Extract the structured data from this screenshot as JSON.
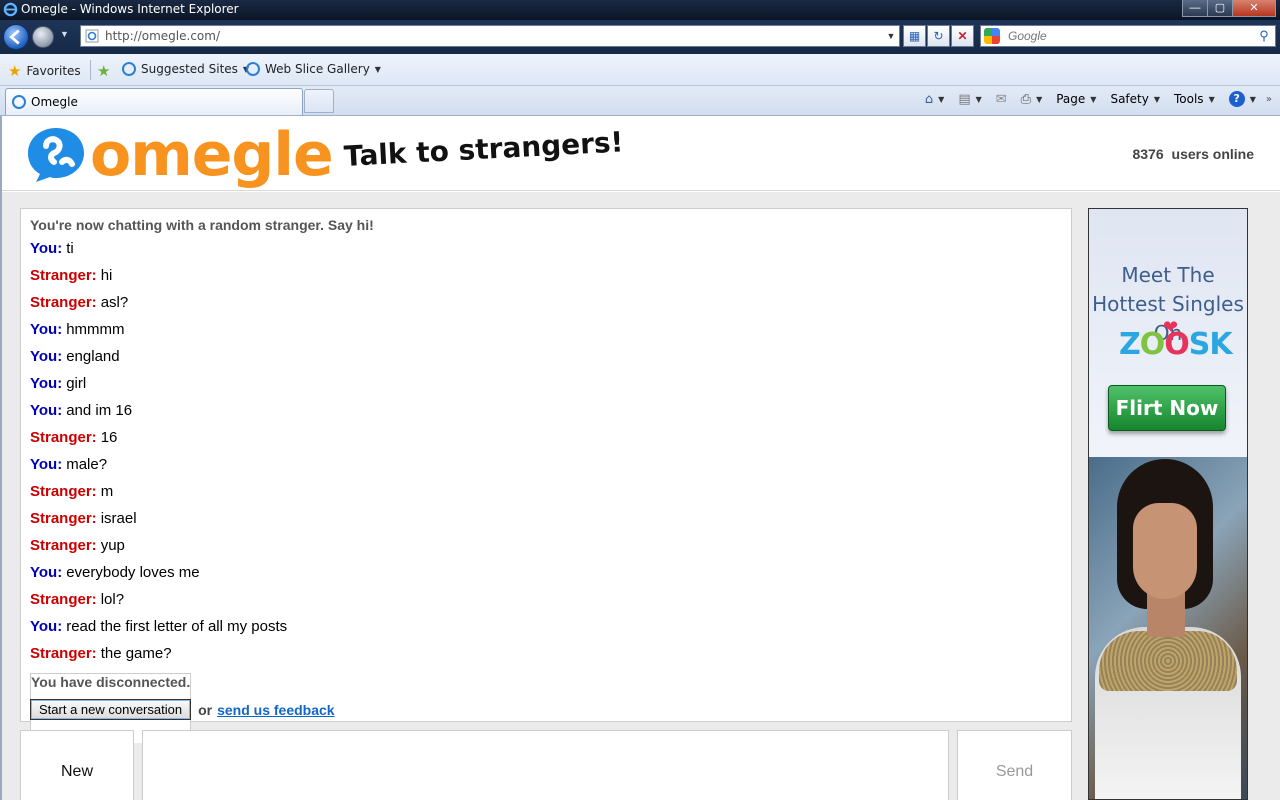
{
  "window": {
    "title": "Omegle - Windows Internet Explorer"
  },
  "navigation": {
    "url": "http://omegle.com/",
    "search_placeholder": "Google"
  },
  "favorites_bar": {
    "favorites_label": "Favorites",
    "suggested_label": "Suggested Sites",
    "webslice_label": "Web Slice Gallery"
  },
  "tabs": [
    {
      "label": "Omegle"
    }
  ],
  "command_bar": {
    "page_label": "Page",
    "safety_label": "Safety",
    "tools_label": "Tools"
  },
  "site": {
    "logo_text": "omegle",
    "tagline": "Talk to strangers!",
    "users_count": "8376",
    "users_suffix": "users online"
  },
  "chat": {
    "status_start": "You're now chatting with a random stranger. Say hi!",
    "you_label": "You:",
    "stranger_label": "Stranger:",
    "messages": [
      {
        "sender": "you",
        "text": "ti"
      },
      {
        "sender": "stranger",
        "text": "hi"
      },
      {
        "sender": "stranger",
        "text": "asl?"
      },
      {
        "sender": "you",
        "text": "hmmmm"
      },
      {
        "sender": "you",
        "text": "england"
      },
      {
        "sender": "you",
        "text": "girl"
      },
      {
        "sender": "you",
        "text": "and im 16"
      },
      {
        "sender": "stranger",
        "text": "16"
      },
      {
        "sender": "you",
        "text": "male?"
      },
      {
        "sender": "stranger",
        "text": "m"
      },
      {
        "sender": "stranger",
        "text": "israel"
      },
      {
        "sender": "stranger",
        "text": "yup"
      },
      {
        "sender": "you",
        "text": "everybody loves me"
      },
      {
        "sender": "stranger",
        "text": "lol?"
      },
      {
        "sender": "you",
        "text": "read the first letter of all my posts"
      },
      {
        "sender": "stranger",
        "text": "the game?"
      }
    ],
    "status_end": "You have disconnected.",
    "new_conversation_label": "Start a new conversation",
    "or_label": "or",
    "feedback_label": "send us feedback"
  },
  "controls": {
    "new_label": "New",
    "send_label": "Send"
  },
  "ad": {
    "headline": "Meet The Hottest Singles On",
    "brand": "ZOOSK",
    "cta": "Flirt Now"
  },
  "colors": {
    "you": "#0000bb",
    "stranger": "#cc0000",
    "brand_orange": "#f7931e",
    "brand_blue": "#1f8ce6"
  }
}
